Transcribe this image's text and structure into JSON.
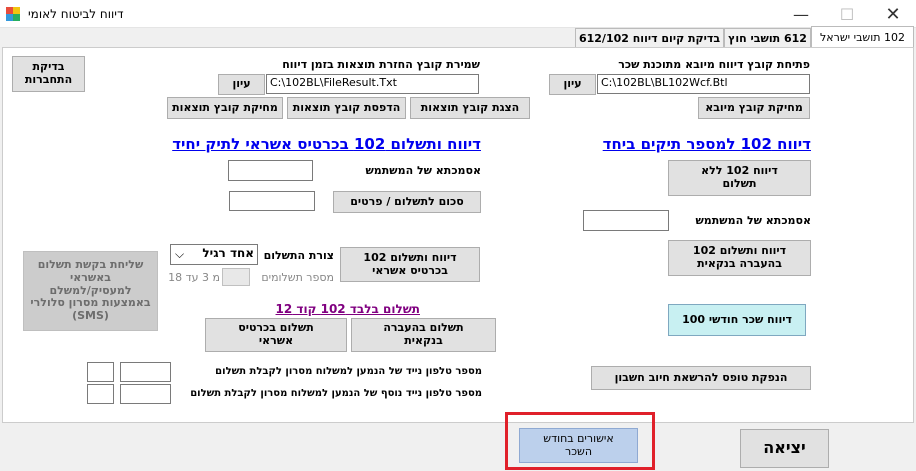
{
  "window": {
    "title": "דיווח לביטוח לאומי",
    "minimize_label": "—",
    "maximize_label": "☐",
    "close_label": "✕"
  },
  "tabs": [
    {
      "label": "102 תושבי ישראל"
    },
    {
      "label": "612 תושבי חוץ"
    },
    {
      "label": "בדיקת קיום דיווח 612/102"
    }
  ],
  "import_section": {
    "label": "פתיחת קובץ דיווח מיובא מתוכנת שכר",
    "path_value": "C:\\102BL\\BL102Wcf.Btl",
    "browse_label": "עיון",
    "delete_button": "מחיקת קובץ מיובא"
  },
  "results_section": {
    "label": "שמירת קובץ החזרת תוצאות בזמן דיווח",
    "path_value": "C:\\102BL\\FileResult.Txt",
    "browse_label": "עיון",
    "show_button": "הצגת קובץ תוצאות",
    "print_button": "הדפסת קובץ תוצאות",
    "delete_button": "מחיקת קובץ תוצאות"
  },
  "connection_check_button": "בדיקת\nהתחברות",
  "left_column": {
    "heading": "דיווח 102 למספר תיקים ביחד",
    "report_no_payment_button": "דיווח 102 ללא\nתשלום",
    "user_token_label": "אסמכתא של המשתמש",
    "user_token_value": "",
    "report_bank_transfer_button": "דיווח ותשלום 102\nבהעברה בנקאית",
    "monthly_salary_button": "דיווח שכר חודשי 100",
    "debit_form_button": "הנפקת טופס להרשאת חיוב חשבון"
  },
  "right_column": {
    "heading": "דיווח ותשלום 102 בכרטיס אשראי לתיק יחיד",
    "user_token_label": "אסמכתא של המשתמש",
    "user_token_value": "",
    "amount_button": "סכום לתשלום / פרטים",
    "amount_value": "",
    "report_credit_button": "דיווח ותשלום 102\nבכרטיס אשראי",
    "payment_form_label": "צורת התשלום",
    "payment_form_value": "אחד רגיל",
    "installments_label": "מספר תשלומים",
    "installments_value": "",
    "installments_hint": "מ 3 עד 18",
    "sms_button": "שליחת בקשת תשלום\nבאשראי\nלמעסיק/למשלם\nבאמצעות מסרון סלולרי\n(SMS)",
    "payment_only_link": "תשלום בלבד 102 קוד 12",
    "pay_bank_button": "תשלום בהעברה\nבנקאית",
    "pay_credit_button": "תשלום בכרטיס\nאשראי",
    "phone_label_1": "מספר טלפון נייד של הנמען למשלוח מסרון לקבלת תשלום",
    "phone_label_2": "מספר טלפון נייד נוסף של הנמען למשלוח מסרון לקבלת תשלום",
    "phone_1_number": "",
    "phone_1_prefix": "",
    "phone_2_number": "",
    "phone_2_prefix": ""
  },
  "bottom": {
    "monthly_approvals_button": "אישורים בחודש\nהשכר",
    "exit_button": "יציאה"
  },
  "colors": {
    "highlight_border": "#e0202a",
    "monthly_salary_bg": "#c8f0f2",
    "approvals_bg": "#bcd0ec"
  }
}
